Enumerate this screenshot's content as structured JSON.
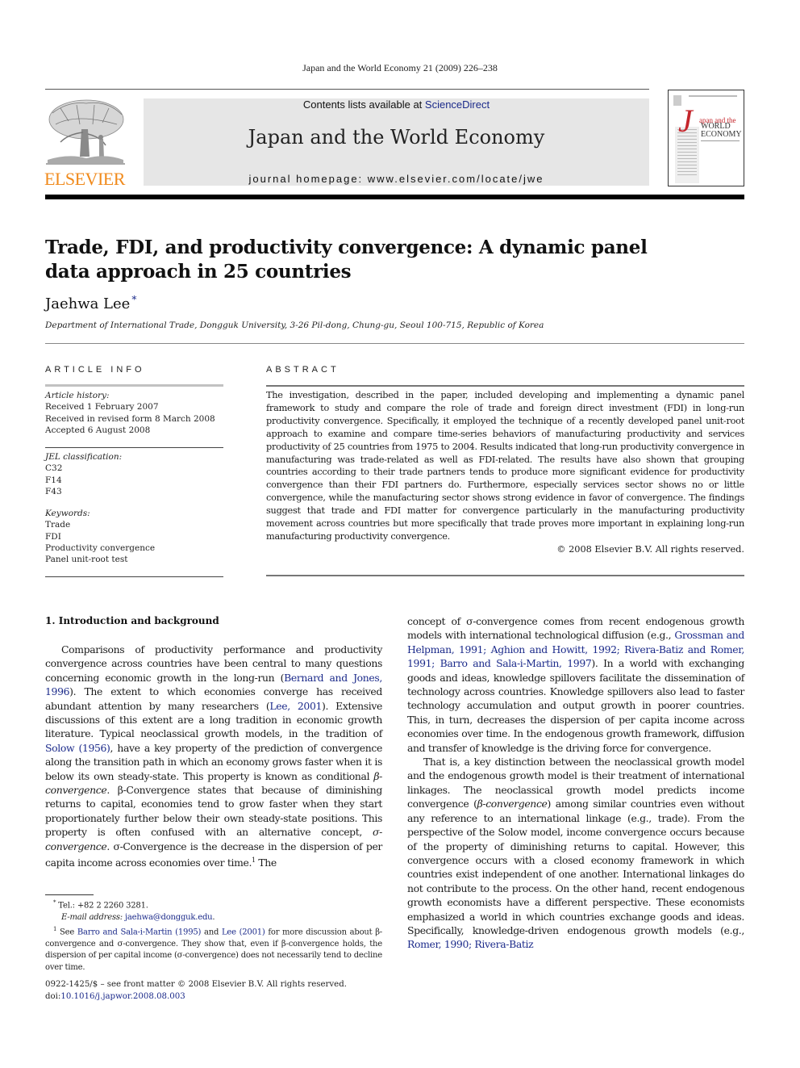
{
  "running_head": "Japan and the World Economy 21 (2009) 226–238",
  "publisher": {
    "logo_text": "ELSEVIER",
    "logo_icon": "elsevier-tree-icon",
    "logo_color": "#f08a1c"
  },
  "masthead": {
    "contents_prefix": "Contents lists available at ",
    "contents_link": "ScienceDirect",
    "journal_name": "Japan and the World Economy",
    "homepage": "journal homepage: www.elsevier.com/locate/jwe"
  },
  "cover": {
    "j": "J",
    "japan": "apan and the",
    "world": "WORLD",
    "economy": "ECONOMY"
  },
  "article": {
    "title": "Trade, FDI, and productivity convergence: A dynamic panel data approach in 25 countries",
    "author": "Jaehwa Lee",
    "author_mark": "*",
    "affiliation": "Department of International Trade, Dongguk University, 3-26 Pil-dong, Chung-gu, Seoul 100-715, Republic of Korea"
  },
  "article_info": {
    "heading": "ARTICLE INFO",
    "history_label": "Article history:",
    "history": [
      "Received 1 February 2007",
      "Received in revised form 8 March 2008",
      "Accepted 6 August 2008"
    ],
    "jel_label": "JEL classification:",
    "jel": [
      "C32",
      "F14",
      "F43"
    ],
    "keywords_label": "Keywords:",
    "keywords": [
      "Trade",
      "FDI",
      "Productivity convergence",
      "Panel unit-root test"
    ]
  },
  "abstract": {
    "heading": "ABSTRACT",
    "text": "The investigation, described in the paper, included developing and implementing a dynamic panel framework to study and compare the role of trade and foreign direct investment (FDI) in long-run productivity convergence. Specifically, it employed the technique of a recently developed panel unit-root approach to examine and compare time-series behaviors of manufacturing productivity and services productivity of 25 countries from 1975 to 2004. Results indicated that long-run productivity convergence in manufacturing was trade-related as well as FDI-related. The results have also shown that grouping countries according to their trade partners tends to produce more significant evidence for productivity convergence than their FDI partners do. Furthermore, especially services sector shows no or little convergence, while the manufacturing sector shows strong evidence in favor of convergence. The findings suggest that trade and FDI matter for convergence particularly in the manufacturing productivity movement across countries but more specifically that trade proves more important in explaining long-run manufacturing productivity convergence.",
    "copyright": "© 2008 Elsevier B.V. All rights reserved."
  },
  "section1": {
    "heading": "1.  Introduction and background",
    "left_p1": [
      {
        "t": "Comparisons of productivity performance and productivity convergence across countries have been central to many questions concerning economic growth in the long-run ("
      },
      {
        "link": "Bernard and Jones, 1996"
      },
      {
        "t": "). The extent to which economies converge has received abundant attention by many researchers ("
      },
      {
        "link": "Lee, 2001"
      },
      {
        "t": "). Extensive discussions of this extent are a long tradition in economic growth literature. Typical neoclassical growth models, in the tradition of "
      },
      {
        "link": "Solow (1956)"
      },
      {
        "t": ", have a key property of the prediction of convergence along the transition path in which an economy grows faster when it is below its own steady-state. This property is known as conditional "
      },
      {
        "em": "β-convergence"
      },
      {
        "t": ". β-Convergence states that because of diminishing returns to capital, economies tend to grow faster when they start proportionately further below their own steady-state positions. This property is often confused with an alternative concept, "
      },
      {
        "em": "σ-convergence"
      },
      {
        "t": ". σ-Convergence is the decrease in the dispersion of per capita income across economies over time."
      },
      {
        "sup": "1"
      },
      {
        "t": " The"
      }
    ],
    "right_p1": [
      {
        "t": "concept of σ-convergence comes from recent endogenous growth models with international technological diffusion (e.g., "
      },
      {
        "link": "Grossman and Helpman, 1991; Aghion and Howitt, 1992; Rivera-Batiz and Romer, 1991; Barro and Sala-i-Martin, 1997"
      },
      {
        "t": "). In a world with exchanging goods and ideas, knowledge spillovers facilitate the dissemination of technology across countries. Knowledge spillovers also lead to faster technology accumulation and output growth in poorer countries. This, in turn, decreases the dispersion of per capita income across economies over time. In the endogenous growth framework, diffusion and transfer of knowledge is the driving force for convergence."
      }
    ],
    "right_p2": [
      {
        "t": "That is, a key distinction between the neoclassical growth model and the endogenous growth model is their treatment of international linkages. The neoclassical growth model predicts income convergence ("
      },
      {
        "em": "β-convergence"
      },
      {
        "t": ") among similar countries even without any reference to an international linkage (e.g., trade). From the perspective of the Solow model, income convergence occurs because of the property of diminishing returns to capital. However, this convergence occurs with a closed economy framework in which countries exist independent of one another. International linkages do not contribute to the process. On the other hand, recent endogenous growth economists have a different perspective. These economists emphasized a world in which countries exchange goods and ideas. Specifically, knowledge-driven endogenous growth models (e.g., "
      },
      {
        "link": "Romer, 1990; Rivera-Batiz"
      }
    ]
  },
  "footnotes": {
    "star_mark": "*",
    "tel": "Tel.: +82 2 2260 3281.",
    "email_label": "E-mail address: ",
    "email": "jaehwa@dongguk.edu",
    "email_end": ".",
    "fn1_mark": "1",
    "fn1": [
      {
        "t": "See "
      },
      {
        "link": "Barro and Sala-i-Martin (1995)"
      },
      {
        "t": " and "
      },
      {
        "link": "Lee (2001)"
      },
      {
        "t": " for more discussion about β-convergence and σ-convergence. They show that, even if β-convergence holds, the dispersion of per capital income (σ-convergence) does not necessarily tend to decline over time."
      }
    ]
  },
  "front_matter": {
    "issn_line": "0922-1425/$ – see front matter © 2008 Elsevier B.V. All rights reserved.",
    "doi_label": "doi:",
    "doi": "10.1016/j.japwor.2008.08.003"
  },
  "colors": {
    "link": "#1b2a8a",
    "masthead_bg": "#e6e6e6",
    "cover_accent": "#c4252b"
  }
}
